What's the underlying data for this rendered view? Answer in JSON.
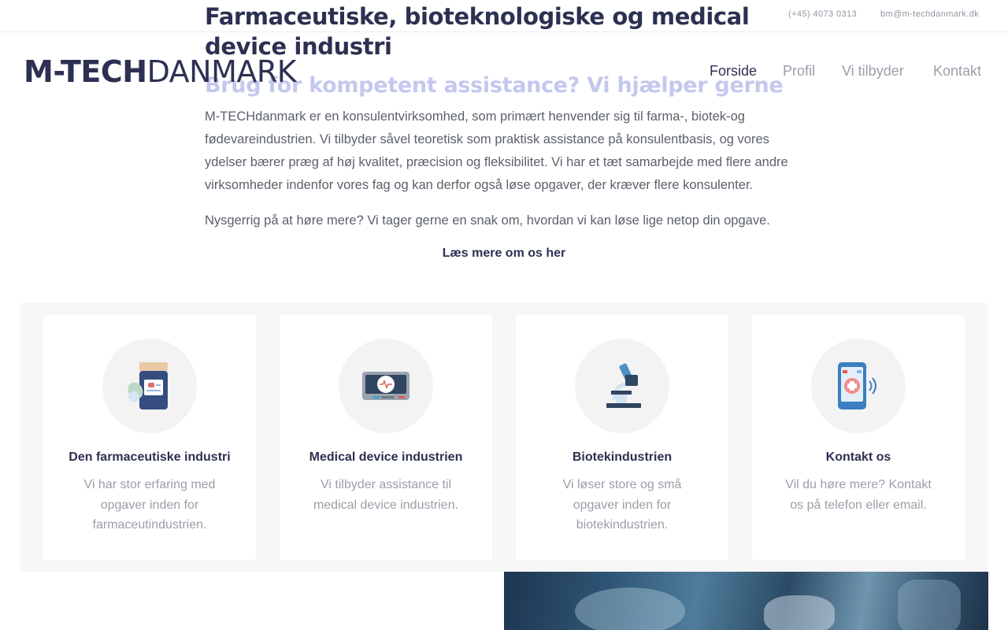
{
  "topbar": {
    "phone": "(+45) 4073 0313",
    "email": "bm@m-techdanmark.dk"
  },
  "logo": {
    "bold": "M-TECH",
    "light": "DANMARK"
  },
  "nav": [
    {
      "label": "Forside",
      "active": true
    },
    {
      "label": "Profil",
      "active": false
    },
    {
      "label": "Vi tilbyder",
      "active": false
    },
    {
      "label": "Kontakt",
      "active": false
    }
  ],
  "hero": {
    "title": "Farmaceutiske, bioteknologiske og medical device industri",
    "subtitle": "Brug for kompetent assistance? Vi hjælper gerne",
    "intro": "M-TECHdanmark er en konsulentvirksomhed, som primært henvender sig til farma-, biotek-og fødevareindustrien. Vi tilbyder såvel teoretisk som praktisk assistance på konsulentbasis, og vores ydelser bærer præg af høj kvalitet, præcision og fleksibilitet. Vi har et tæt samarbejde med flere andre virksomheder indenfor vores fag og kan derfor også løse opgaver, der kræver flere konsulenter.",
    "intro2": "Nysgerrig på at høre mere? Vi tager gerne en snak om, hvordan vi kan løse lige netop din opgave.",
    "readmore": "Læs mere om os her"
  },
  "cards": [
    {
      "title": "Den farmaceutiske industri",
      "text": "Vi har stor erfaring med opgaver inden for farmaceutindustrien.",
      "icon": "medicine-bottle-icon"
    },
    {
      "title": "Medical device industrien",
      "text": "Vi tilbyder assistance til medical device industrien.",
      "icon": "medical-monitor-icon"
    },
    {
      "title": "Biotekindustrien",
      "text": "Vi løser store og små opgaver inden for biotekindustrien.",
      "icon": "microscope-icon"
    },
    {
      "title": "Kontakt os",
      "text": "Vil du høre mere? Kontakt os på telefon eller email.",
      "icon": "medical-phone-icon"
    }
  ],
  "colors": {
    "brand": "#2c3152",
    "subtitle": "#c3c8ee",
    "muted": "#9a9ea8",
    "band": "#f6f6f6"
  }
}
